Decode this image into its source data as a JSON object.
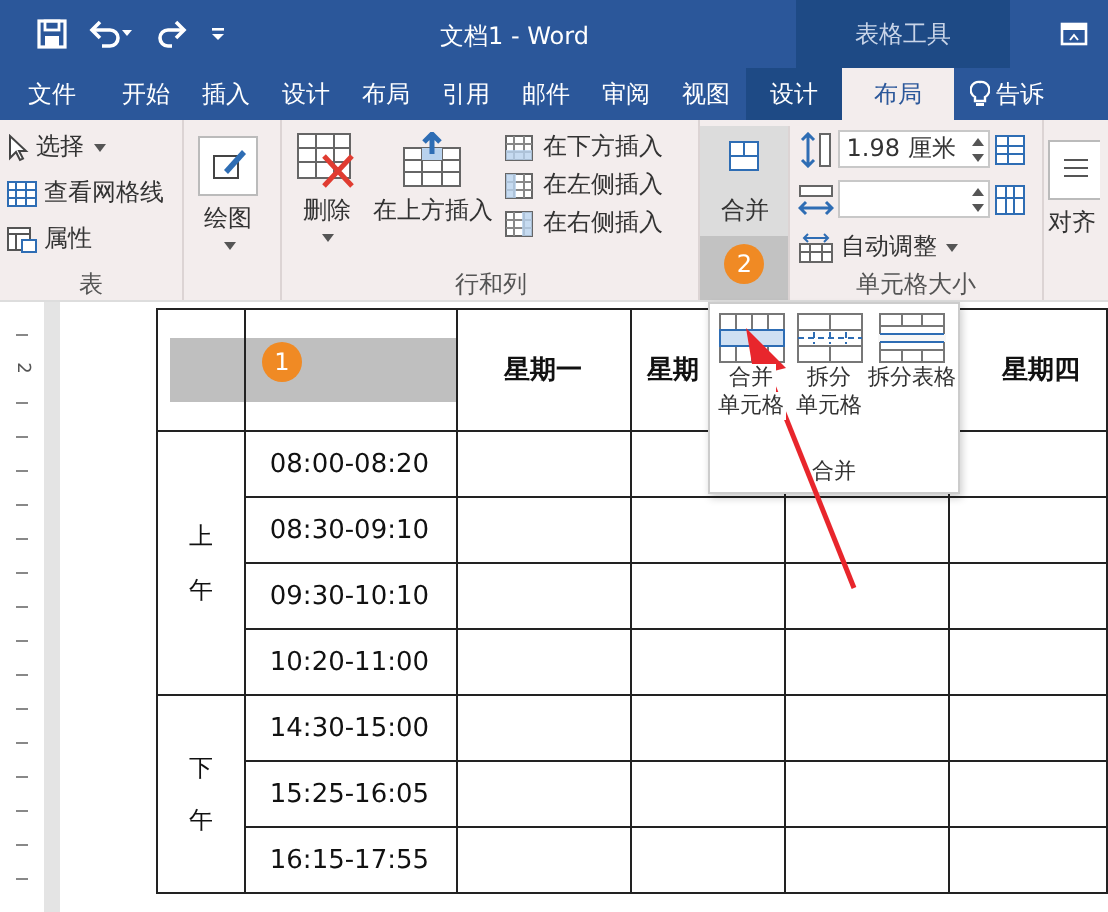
{
  "title_bar": {
    "title": "文档1 - Word",
    "context_label": "表格工具"
  },
  "tabs": [
    {
      "label": "文件",
      "selected": false,
      "context": false
    },
    {
      "label": "开始",
      "selected": false,
      "context": false
    },
    {
      "label": "插入",
      "selected": false,
      "context": false
    },
    {
      "label": "设计",
      "selected": false,
      "context": false
    },
    {
      "label": "布局",
      "selected": false,
      "context": false
    },
    {
      "label": "引用",
      "selected": false,
      "context": false
    },
    {
      "label": "邮件",
      "selected": false,
      "context": false
    },
    {
      "label": "审阅",
      "selected": false,
      "context": false
    },
    {
      "label": "视图",
      "selected": false,
      "context": false
    },
    {
      "label": "设计",
      "selected": false,
      "context": true
    },
    {
      "label": "布局",
      "selected": true,
      "context": true
    }
  ],
  "tell_me": "告诉",
  "ribbon": {
    "table_group": {
      "label": "表",
      "items": [
        {
          "label": "选择",
          "dropdown": true
        },
        {
          "label": "查看网格线",
          "dropdown": false
        },
        {
          "label": "属性",
          "dropdown": false
        }
      ]
    },
    "draw": {
      "label": "绘图"
    },
    "rows_cols": {
      "label": "行和列",
      "delete": "删除",
      "insert_above": "在上方插入",
      "small_items": [
        "在下方插入",
        "在左侧插入",
        "在右侧插入"
      ]
    },
    "merge": {
      "label": "合并",
      "pressed": true,
      "badge": "2"
    },
    "cell_size": {
      "label": "单元格大小",
      "height": "1.98 厘米",
      "autofit": "自动调整"
    },
    "align": {
      "label": "对齐"
    }
  },
  "merge_menu": {
    "items": [
      {
        "lines": [
          "合并",
          "单元格"
        ],
        "kind": "merge"
      },
      {
        "lines": [
          "拆分",
          "单元格"
        ],
        "kind": "split"
      },
      {
        "lines": [
          "拆分表格"
        ],
        "kind": "table"
      }
    ],
    "group_label": "合并"
  },
  "ruler": {
    "label": "2"
  },
  "table": {
    "header": [
      {
        "selected": true
      },
      {
        "selected": true,
        "badge": "1"
      },
      {
        "text": "星期一",
        "selected": false
      },
      {
        "text": "星期",
        "selected": false
      },
      {
        "text": "星期四",
        "selected": false
      }
    ],
    "periods": [
      {
        "label": "上午",
        "times": [
          "08:00-08:20",
          "08:30-09:10",
          "09:30-10:10",
          "10:20-11:00"
        ]
      },
      {
        "label": "下午",
        "times": [
          "14:30-15:00",
          "15:25-16:05",
          "16:15-17:55"
        ]
      }
    ]
  }
}
